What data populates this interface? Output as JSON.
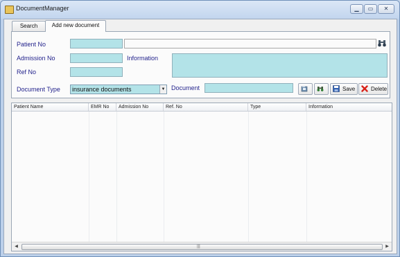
{
  "window": {
    "title": "DocumentManager",
    "controls": {
      "minimize": "▁",
      "maximize": "▭",
      "close": "✕"
    }
  },
  "tabs": [
    {
      "label": "Search",
      "active": false
    },
    {
      "label": "Add new document",
      "active": true
    }
  ],
  "form": {
    "patient_no": {
      "label": "Patient No",
      "value": "",
      "name_value": ""
    },
    "admission_no": {
      "label": "Admission No",
      "value": ""
    },
    "ref_no": {
      "label": "Ref No",
      "value": ""
    },
    "information": {
      "label": "Information",
      "value": ""
    },
    "document_type": {
      "label": "Document Type",
      "value": "insurance documents"
    },
    "document": {
      "label": "Document",
      "value": ""
    }
  },
  "buttons": {
    "save": "Save",
    "delete": "Delete"
  },
  "grid": {
    "columns": [
      "Patient Name",
      "EMR No",
      "Admission No",
      "Ref. No",
      "Type",
      "Information"
    ],
    "rows": []
  },
  "colors": {
    "input_fill": "#b3e3e8",
    "label_text": "#1f1f8a",
    "window_frame": "#bcd0ea"
  }
}
